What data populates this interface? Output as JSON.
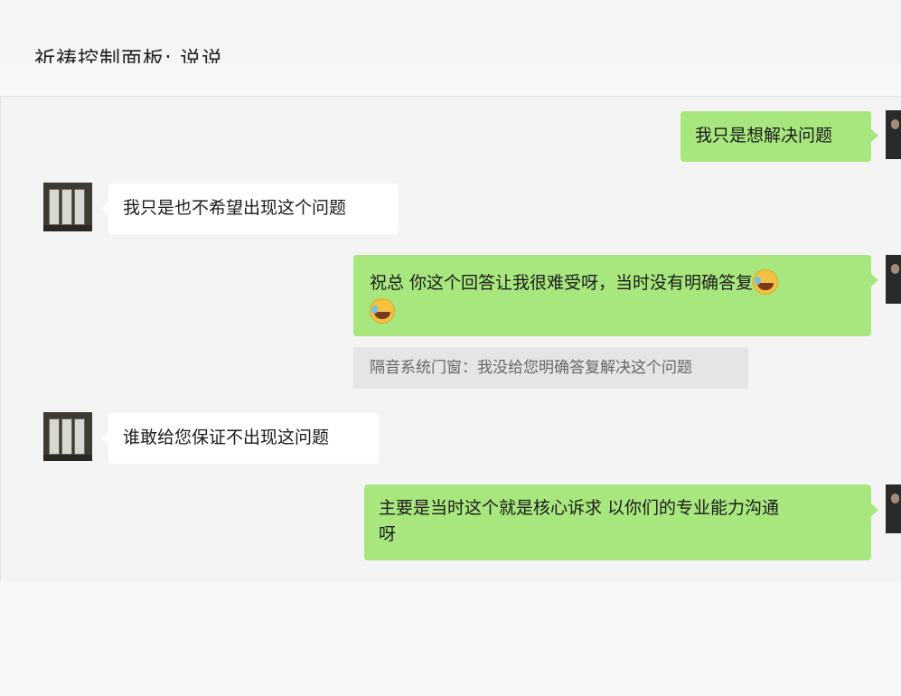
{
  "header": {
    "title": "祈祷控制面板: 说说"
  },
  "messages": [
    {
      "side": "mine",
      "text": "我只是想解决问题"
    },
    {
      "side": "theirs",
      "text": "我只是也不希望出现这个问题"
    },
    {
      "side": "mine",
      "line1": "祝总  你这个回答让我很难受呀，当时没有明确答复",
      "emoji": "grinning-sweat-emoji"
    },
    {
      "side": "system",
      "text": "隔音系统门窗：我没给您明确答复解决这个问题"
    },
    {
      "side": "theirs",
      "text": "谁敢给您保证不出现这问题"
    },
    {
      "side": "mine",
      "line1": "主要是当时这个就是核心诉求  以你们的专业能力沟通",
      "line2": "呀"
    }
  ],
  "colors": {
    "mine_bubble": "#a8e67e",
    "theirs_bubble": "#ffffff",
    "chat_background": "#f4f4f4",
    "system_note": "#e5e5e5"
  },
  "icons": {
    "contact_avatar": "window-photo-avatar",
    "own_avatar": "person-photo-avatar"
  }
}
